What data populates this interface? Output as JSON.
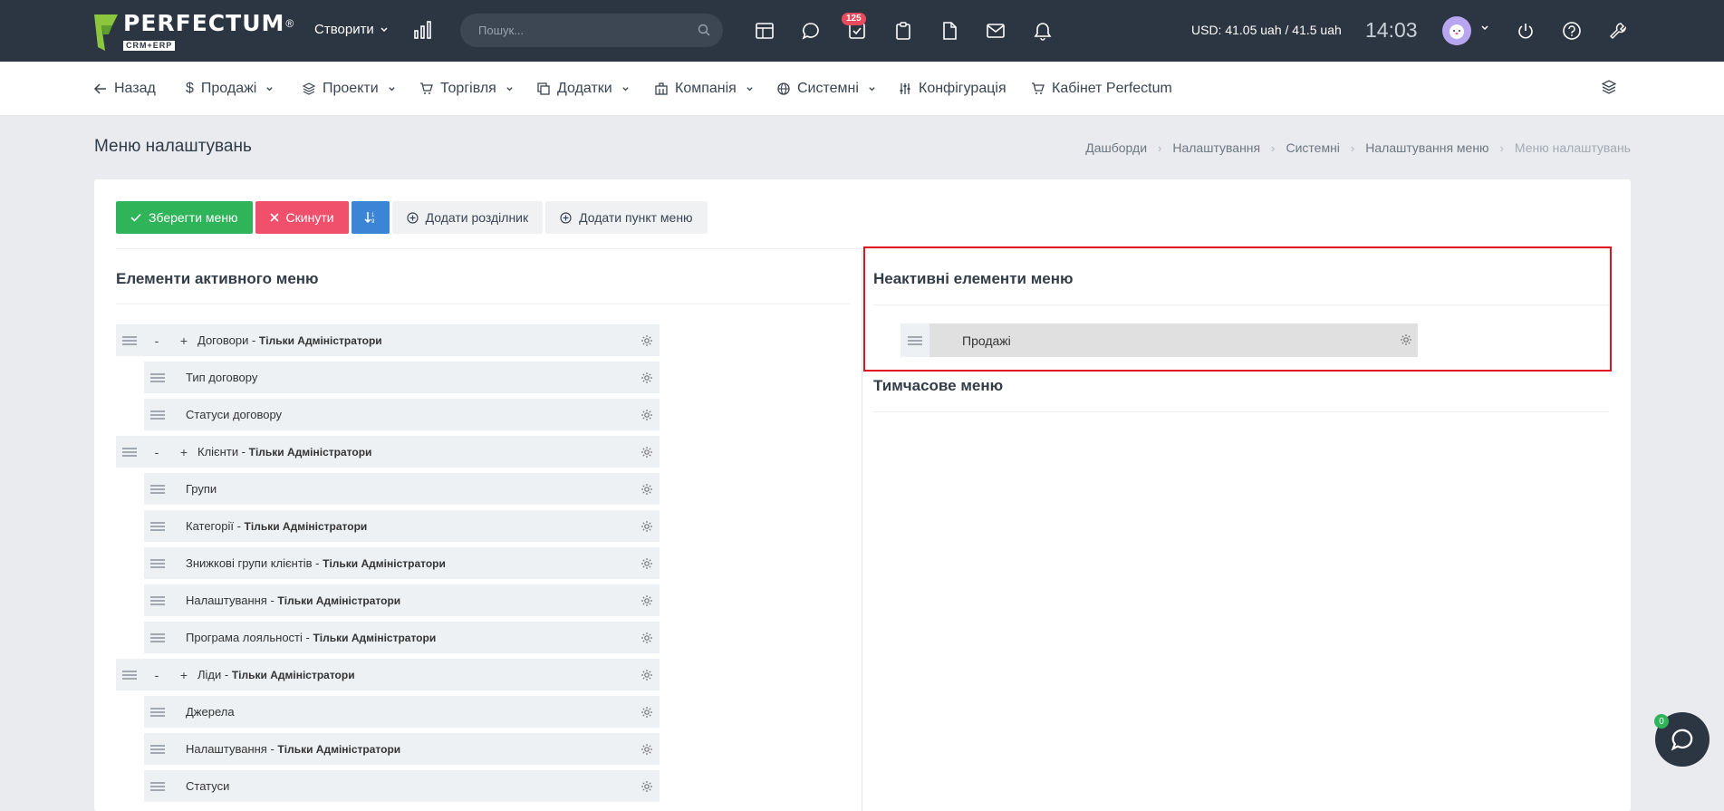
{
  "topbar": {
    "logo_name": "PERFECTUM",
    "logo_reg": "®",
    "logo_sub": "CRM+ERP",
    "create_label": "Створити",
    "search_placeholder": "Пошук...",
    "tasks_badge": "125",
    "currency": "USD: 41.05 uah / 41.5 uah",
    "time": "14:03"
  },
  "nav": {
    "back": "Назад",
    "sales": "Продажі",
    "projects": "Проекти",
    "trade": "Торгівля",
    "addons": "Додатки",
    "company": "Компанія",
    "system": "Системні",
    "config": "Конфігурація",
    "cabinet": "Кабінет Perfectum"
  },
  "page": {
    "title": "Меню налаштувань",
    "breadcrumb": [
      "Дашборди",
      "Налаштування",
      "Системні",
      "Налаштування меню",
      "Меню налаштувань"
    ]
  },
  "toolbar": {
    "save": "Зберегти меню",
    "reset": "Скинути",
    "add_divider": "Додати розділник",
    "add_item": "Додати пункт меню"
  },
  "active": {
    "title": "Елементи активного меню",
    "items": [
      {
        "text": "Договори - ",
        "bold": "Тільки Адміністратори",
        "level": 0
      },
      {
        "text": "Тип договору",
        "bold": "",
        "level": 1
      },
      {
        "text": "Статуси договору",
        "bold": "",
        "level": 1
      },
      {
        "text": "Клієнти - ",
        "bold": "Тільки Адміністратори",
        "level": 0
      },
      {
        "text": "Групи",
        "bold": "",
        "level": 1
      },
      {
        "text": "Категорії - ",
        "bold": "Тільки Адміністратори",
        "level": 1
      },
      {
        "text": "Знижкові групи клієнтів - ",
        "bold": "Тільки Адміністратори",
        "level": 1
      },
      {
        "text": "Налаштування - ",
        "bold": "Тільки Адміністратори",
        "level": 1
      },
      {
        "text": "Програма лояльності - ",
        "bold": "Тільки Адміністратори",
        "level": 1
      },
      {
        "text": "Ліди - ",
        "bold": "Тільки Адміністратори",
        "level": 0
      },
      {
        "text": "Джерела",
        "bold": "",
        "level": 1
      },
      {
        "text": "Налаштування - ",
        "bold": "Тільки Адміністратори",
        "level": 1
      },
      {
        "text": "Статуси",
        "bold": "",
        "level": 1
      }
    ],
    "collapse_sign": "-",
    "expand_sign": "+"
  },
  "inactive": {
    "title": "Неактивні елементи меню",
    "item": "Продажі"
  },
  "temp": {
    "title": "Тимчасове меню"
  },
  "chat": {
    "badge": "0"
  },
  "colors": {
    "topbar": "#2c3542",
    "save": "#2fb45a",
    "reset": "#f1506c",
    "sort": "#3c84d6",
    "highlight": "#e0141f"
  }
}
